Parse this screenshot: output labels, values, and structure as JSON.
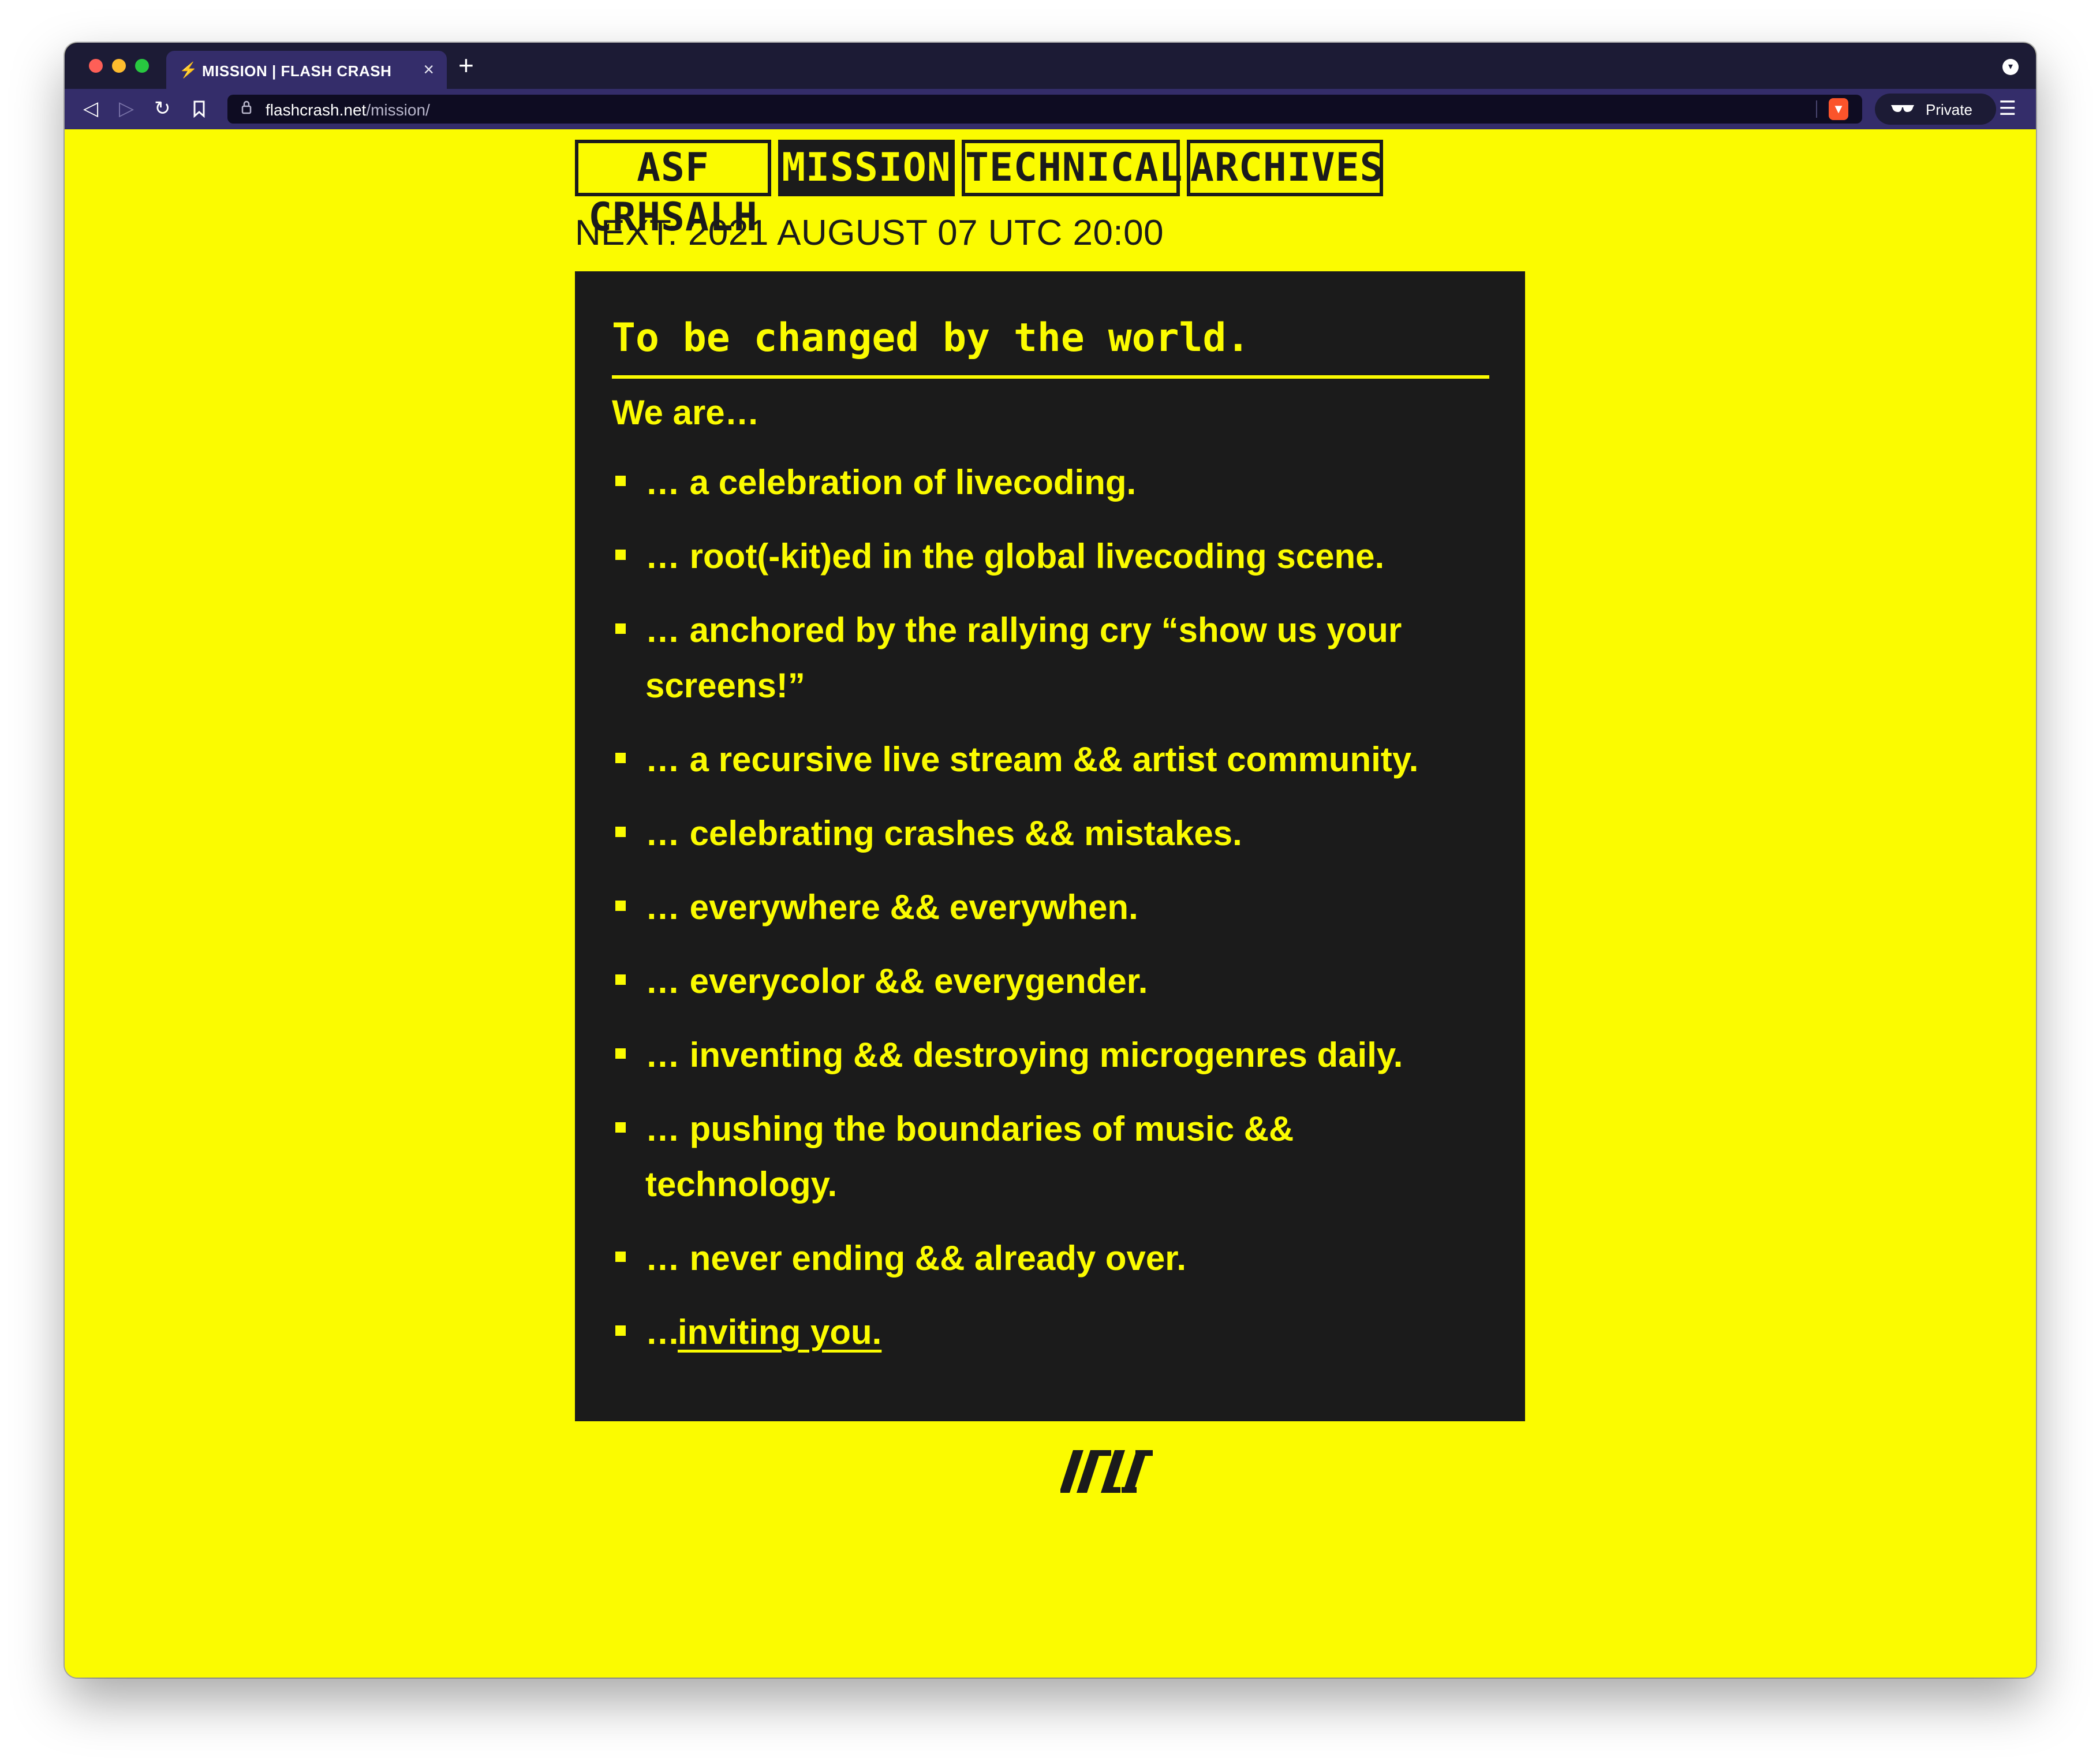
{
  "browser": {
    "tab_title": "MISSION | FLASH CRASH",
    "url_host": "flashcrash.net",
    "url_path": "/mission/",
    "private_label": "Private",
    "tab_close": "×",
    "new_tab": "+",
    "favicon": "⚡",
    "icons": [
      "back-icon",
      "forward-icon",
      "reload-icon",
      "bookmark-icon",
      "lock-icon",
      "brave-shield-icon",
      "private-glasses-icon",
      "menu-icon"
    ]
  },
  "nav": {
    "home": "ASF CRHSALH",
    "mission": "MISSION",
    "technical": "TECHNICAL",
    "archives": "ARCHIVES",
    "active": "mission"
  },
  "next_event": "NEXT: 2021 AUGUST 07 UTC 20:00",
  "content": {
    "heading": "To be changed by the world.",
    "intro": "We are…",
    "items": [
      "… a celebration of livecoding.",
      "… root(-kit)ed in the global livecoding scene.",
      "… anchored by the rallying cry “show us your screens!”",
      "… a recursive live stream && artist community.",
      "… celebrating crashes && mistakes.",
      "… everywhere && everywhen.",
      "… everycolor && everygender.",
      "… inventing && destroying microgenres daily.",
      "… pushing the boundaries of music && technology.",
      "… never ending && already over."
    ],
    "last_item_prefix": "…",
    "last_item_link": "inviting you."
  },
  "colors": {
    "background": "#fbfb00",
    "panel": "#1b1b1b",
    "text_on_panel": "#fbfb00"
  }
}
